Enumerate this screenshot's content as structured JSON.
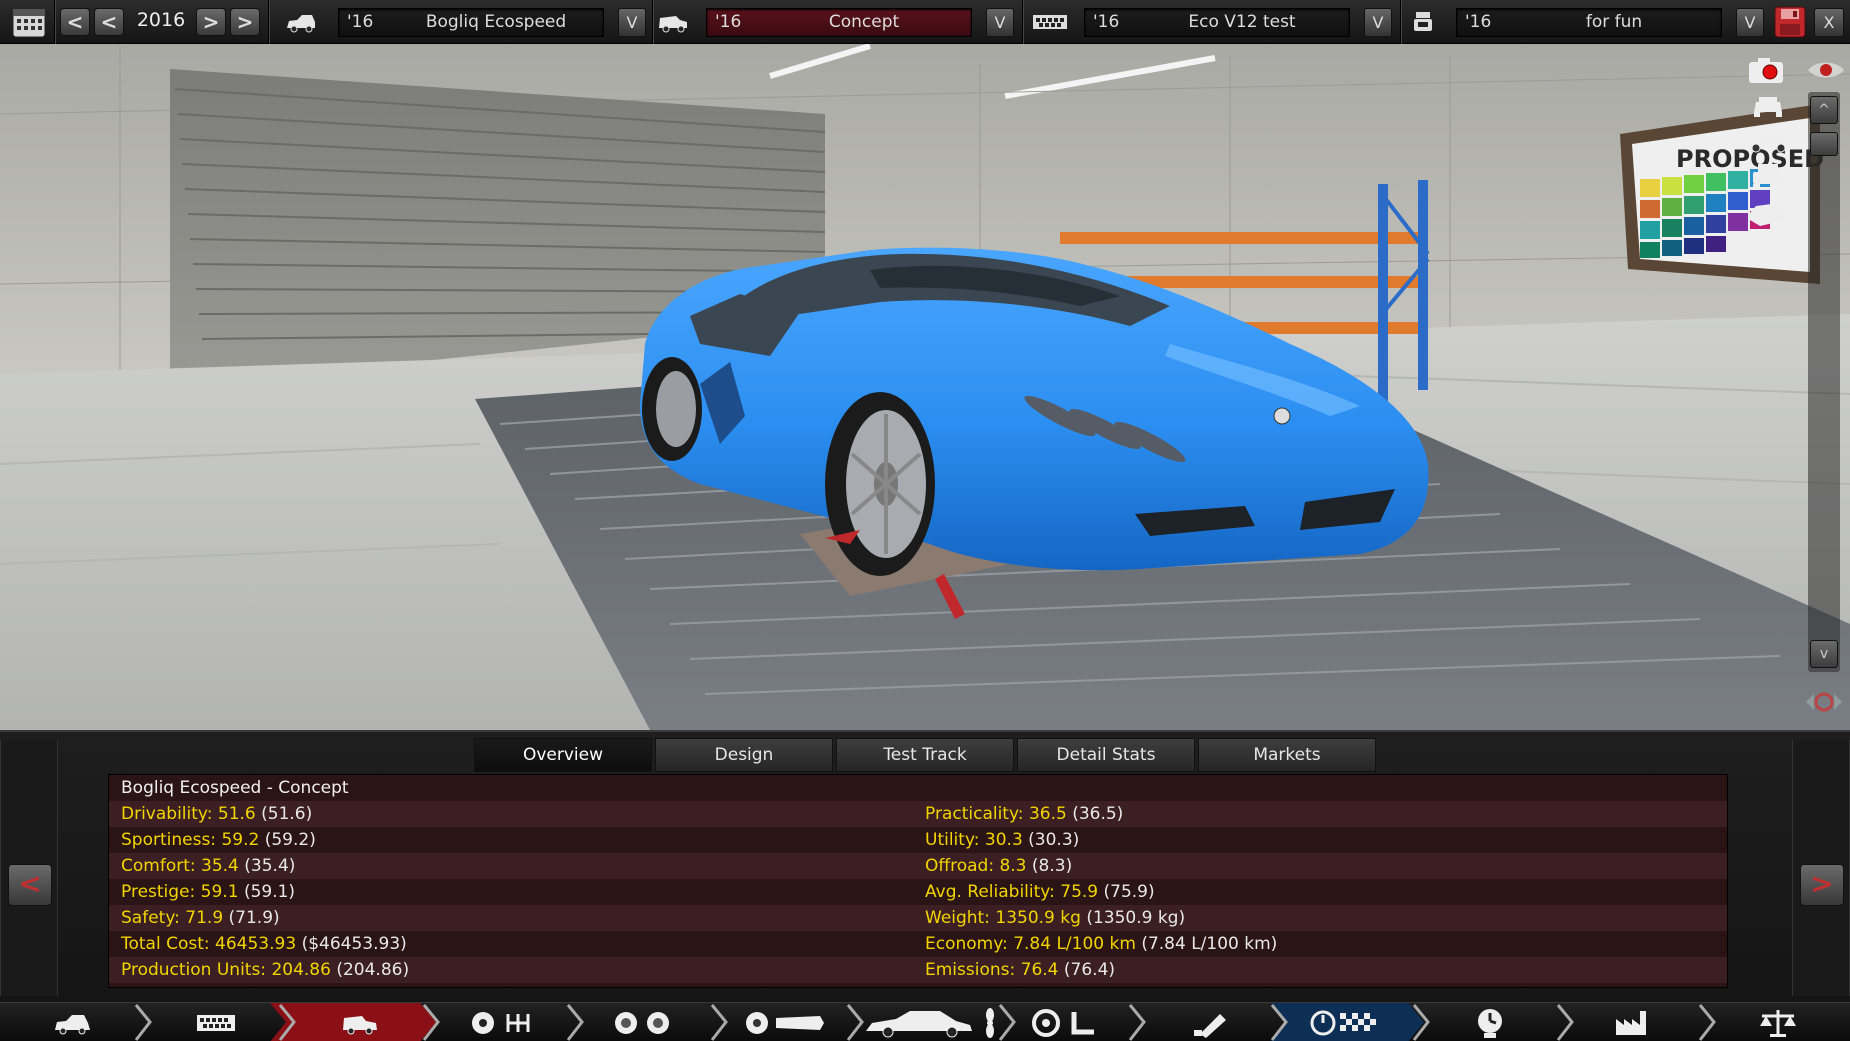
{
  "topbar": {
    "year": "2016",
    "model": {
      "year": "'16",
      "name": "Bogliq Ecospeed"
    },
    "trim": {
      "year": "'16",
      "name": "Concept"
    },
    "engine": {
      "year": "'16",
      "name": "Eco V12 test"
    },
    "variant": {
      "year": "'16",
      "name": "for fun"
    },
    "prev_label": "<",
    "next_label": ">",
    "dropdown_label": "V",
    "close_label": "X"
  },
  "viewport": {
    "sign_text": "PROPOSED",
    "scroll_up": "^",
    "scroll_down": "v"
  },
  "panel": {
    "tabs": [
      "Overview",
      "Design",
      "Test Track",
      "Detail Stats",
      "Markets"
    ],
    "active_tab": "Overview",
    "title": "Bogliq Ecospeed - Concept",
    "left_stats": [
      {
        "label": "Drivability:",
        "value": "51.6",
        "paren": "(51.6)"
      },
      {
        "label": "Sportiness:",
        "value": "59.2",
        "paren": "(59.2)"
      },
      {
        "label": "Comfort:",
        "value": "35.4",
        "paren": "(35.4)"
      },
      {
        "label": "Prestige:",
        "value": "59.1",
        "paren": "(59.1)"
      },
      {
        "label": "Safety:",
        "value": "71.9",
        "paren": "(71.9)"
      },
      {
        "label": "Total Cost:",
        "value": "46453.93",
        "paren": "($46453.93)"
      },
      {
        "label": "Production Units:",
        "value": "204.86",
        "paren": "(204.86)"
      }
    ],
    "right_stats": [
      {
        "label": "Practicality:",
        "value": "36.5",
        "paren": "(36.5)"
      },
      {
        "label": "Utility:",
        "value": "30.3",
        "paren": "(30.3)"
      },
      {
        "label": "Offroad:",
        "value": "8.3",
        "paren": "(8.3)"
      },
      {
        "label": "Avg. Reliability:",
        "value": "75.9",
        "paren": "(75.9)"
      },
      {
        "label": "Weight:",
        "value": "1350.9 kg",
        "paren": "(1350.9 kg)"
      },
      {
        "label": "Economy:",
        "value": "7.84 L/100 km",
        "paren": "(7.84 L/100 km)"
      },
      {
        "label": "Emissions:",
        "value": "76.4",
        "paren": "(76.4)"
      }
    ],
    "prev_label": "<",
    "next_label": ">"
  },
  "colors": {
    "car_blue": "#2b8ef0",
    "stat_yellow": "#f2d500",
    "active_red": "#8a1016",
    "panel_bg": "#2b1416"
  },
  "bottomnav": {
    "items": [
      "model-icon",
      "engine-icon",
      "trim-icon",
      "gearbox-icon",
      "wheels-icon",
      "chassis-icon",
      "body-icon",
      "steering-icon",
      "fuel-icon",
      "tune-icon",
      "timeline-icon",
      "factory-icon",
      "balance-icon"
    ]
  }
}
